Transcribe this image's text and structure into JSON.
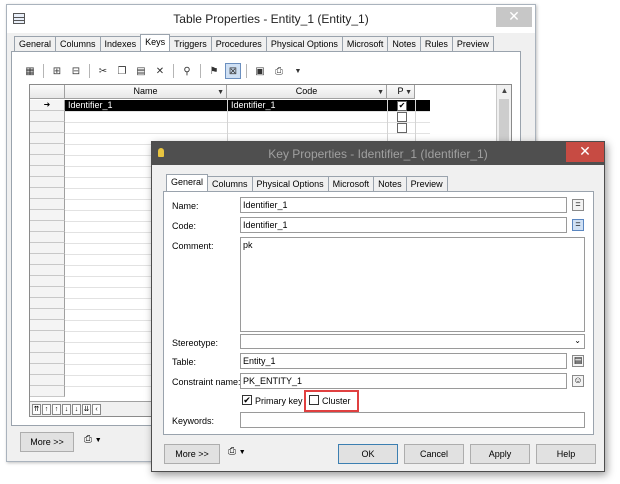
{
  "outer": {
    "title": "Table Properties - Entity_1 (Entity_1)",
    "close_glyph": "✕",
    "tabs": [
      "General",
      "Columns",
      "Indexes",
      "Keys",
      "Triggers",
      "Procedures",
      "Physical Options",
      "Microsoft",
      "Notes",
      "Rules",
      "Preview"
    ],
    "active_tab": "Keys",
    "grid": {
      "columns": [
        "Name",
        "Code",
        "P"
      ],
      "rows": [
        {
          "name": "Identifier_1",
          "code": "Identifier_1",
          "primary": true
        }
      ]
    },
    "more_label": "More >>"
  },
  "inner": {
    "title": "Key Properties - Identifier_1 (Identifier_1)",
    "close_glyph": "✕",
    "tabs": [
      "General",
      "Columns",
      "Physical Options",
      "Microsoft",
      "Notes",
      "Preview"
    ],
    "active_tab": "General",
    "labels": {
      "name": "Name:",
      "code": "Code:",
      "comment": "Comment:",
      "stereotype": "Stereotype:",
      "table": "Table:",
      "constraint": "Constraint name:",
      "keywords": "Keywords:"
    },
    "values": {
      "name": "Identifier_1",
      "code": "Identifier_1",
      "comment": "pk",
      "stereotype": "",
      "table": "Entity_1",
      "constraint": "PK_ENTITY_1",
      "keywords": ""
    },
    "checkboxes": {
      "primary_key_label": "Primary key",
      "primary_key_checked": true,
      "cluster_label": "Cluster",
      "cluster_checked": false
    },
    "buttons": {
      "more": "More >>",
      "ok": "OK",
      "cancel": "Cancel",
      "apply": "Apply",
      "help": "Help"
    }
  }
}
